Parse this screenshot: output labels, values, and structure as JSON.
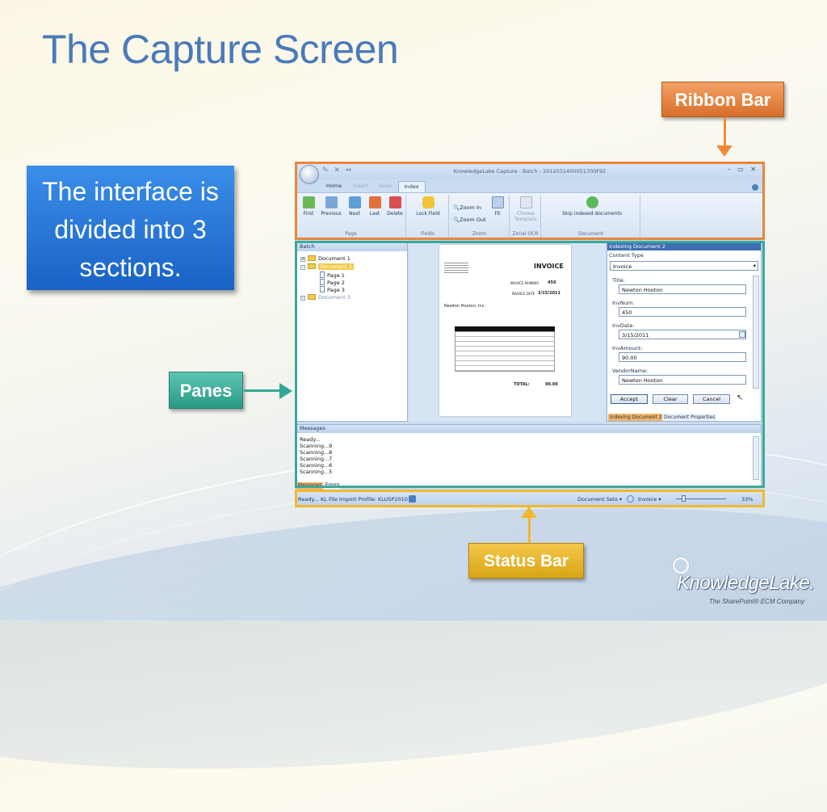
{
  "slide": {
    "title": "The Capture Screen",
    "intro": "The interface is divided into 3 sections.",
    "callouts": {
      "ribbon": "Ribbon Bar",
      "panes": "Panes",
      "status": "Status Bar"
    },
    "colors": {
      "ribbon": "#e8863a",
      "panes": "#3aa999",
      "status": "#f1b92c",
      "title": "#4a7ab8"
    }
  },
  "app": {
    "window_title": "KnowledgeLake Capture - Batch - 2012031400051700F92",
    "tabs": [
      "Home",
      "Insert",
      "Scan",
      "Index"
    ],
    "active_tab": "Index",
    "ribbon": {
      "page": {
        "buttons": [
          "First",
          "Previous",
          "Next",
          "Last",
          "Delete"
        ],
        "label": "Page"
      },
      "fields": {
        "buttons": [
          "Lock Field"
        ],
        "label": "Fields"
      },
      "zoom": {
        "zoom_in": "Zoom In",
        "zoom_out": "Zoom Out",
        "fit": "Fit",
        "label": "Zoom"
      },
      "zonal_ocr": {
        "button": "Choose Template",
        "label": "Zonal OCR"
      },
      "document": {
        "button": "Skip indexed documents",
        "label": "Document"
      }
    },
    "batch_pane": {
      "title": "Batch",
      "items": [
        "Document 1",
        "Document 2",
        "Page 1",
        "Page 2",
        "Page 3",
        "Document 3"
      ]
    },
    "invoice": {
      "heading": "INVOICE",
      "number_label": "INVOICE NUMBER",
      "number": "450",
      "date_label": "INVOICE DATE",
      "date": "3/15/2011",
      "vendor": "Newton Hooton, Inc.",
      "total_label": "TOTAL:",
      "total": "90.00"
    },
    "indexing_pane": {
      "title": "Indexing Document 2",
      "content_type_label": "Content Type",
      "content_type": "Invoice",
      "fields": [
        {
          "label": "Title:",
          "value": "Newton Hooton"
        },
        {
          "label": "InvNum:",
          "value": "450"
        },
        {
          "label": "InvDate:",
          "value": "3/15/2011"
        },
        {
          "label": "InvAmount:",
          "value": "90.00"
        },
        {
          "label": "VendorName:",
          "value": "Newton Hooton"
        }
      ],
      "buttons": {
        "accept": "Accept",
        "clear": "Clear",
        "cancel": "Cancel"
      },
      "tabs": [
        "Indexing Document 2",
        "Document Properties"
      ]
    },
    "messages": {
      "title": "Messages",
      "lines": [
        "Ready...",
        "Scanning...9",
        "Scanning...8",
        "Scanning...7",
        "Scanning...6",
        "Scanning...5"
      ],
      "tabs": [
        "Messages",
        "Errors"
      ]
    },
    "status": {
      "ready": "Ready...",
      "profile": "KL File Import  Profile: KLUSP2010",
      "document_sets": "Document Sets",
      "content_type": "Invoice",
      "zoom": "33%"
    }
  },
  "logo": {
    "name": "KnowledgeLake.",
    "tagline": "The SharePoint® ECM Company"
  }
}
